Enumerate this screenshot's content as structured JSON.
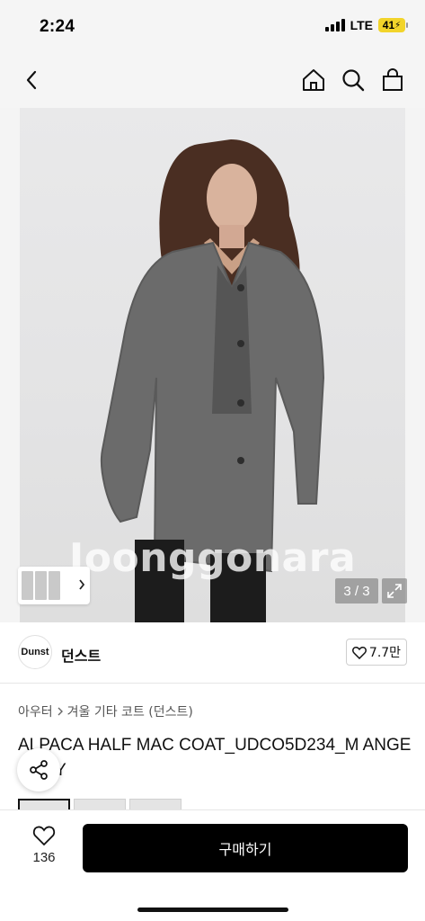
{
  "status_bar": {
    "time": "2:24",
    "network": "LTE",
    "battery": "41"
  },
  "nav": {
    "back_icon": "chevron-left-icon",
    "home_icon": "home-icon",
    "search_icon": "search-icon",
    "cart_icon": "shopping-bag-icon"
  },
  "gallery": {
    "watermark": "Joonggonara",
    "counter": "3 / 3",
    "expand_icon": "expand-icon"
  },
  "shop": {
    "logo_text": "Dunst",
    "name": "던스트",
    "likes": "7.7만"
  },
  "breadcrumb": {
    "category": "아우터",
    "subcategory": "겨울 기타 코트 (던스트)"
  },
  "product": {
    "title": "ALPACA HALF MAC COAT_UDCO5D234_M ANGE GREY"
  },
  "actions": {
    "share_icon": "share-icon",
    "favorite_count": "136",
    "buy_label": "구매하기"
  },
  "colors": {
    "buy_button": "#000000",
    "background": "#ffffff",
    "header_bg": "#f5f5f5",
    "battery": "#f2d42a"
  }
}
